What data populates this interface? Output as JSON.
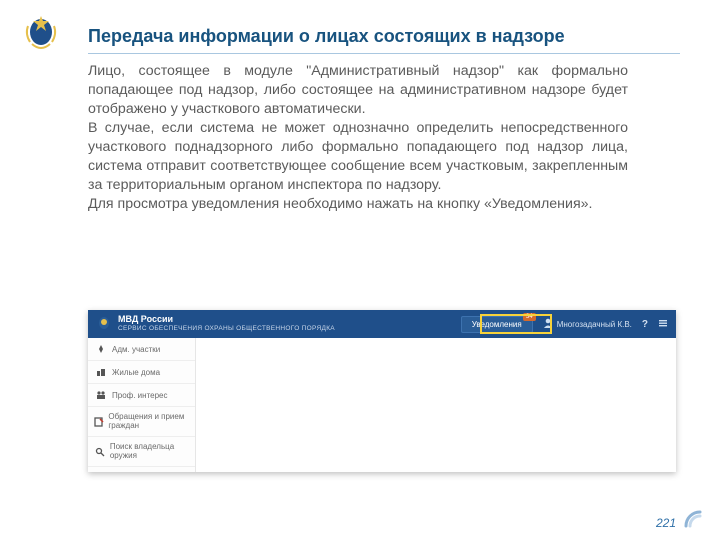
{
  "heading": "Передача информации о лицах состоящих в надзоре",
  "paragraphs": {
    "p1": "Лицо, состоящее в модуле \"Административный надзор\" как формально попадающее под надзор, либо состоящее на административном надзоре будет отображено  у участкового автоматически.",
    "p2": "В случае, если система не может однозначно определить непосредственного участкового поднадзорного либо формально попадающего под надзор лица, система отправит соответствующее сообщение всем участковым, закрепленным за территориальным органом инспектора по надзору.",
    "p3": "Для просмотра уведомления необходимо нажать на кнопку «Уведомления»."
  },
  "screenshot": {
    "service_line1": "МВД России",
    "service_line2": "СЕРВИС ОБЕСПЕЧЕНИЯ ОХРАНЫ ОБЩЕСТВЕННОГО ПОРЯДКА",
    "notify_label": "Уведомления",
    "notify_count": "34",
    "user_name": "Многозадачный К.В.",
    "help": "?",
    "sidebar": {
      "i0": "Адм. участки",
      "i1": "Жилые дома",
      "i2": "Проф. интерес",
      "i3": "Обращения и прием граждан",
      "i4": "Поиск владельца оружия"
    }
  },
  "page_number": "221"
}
